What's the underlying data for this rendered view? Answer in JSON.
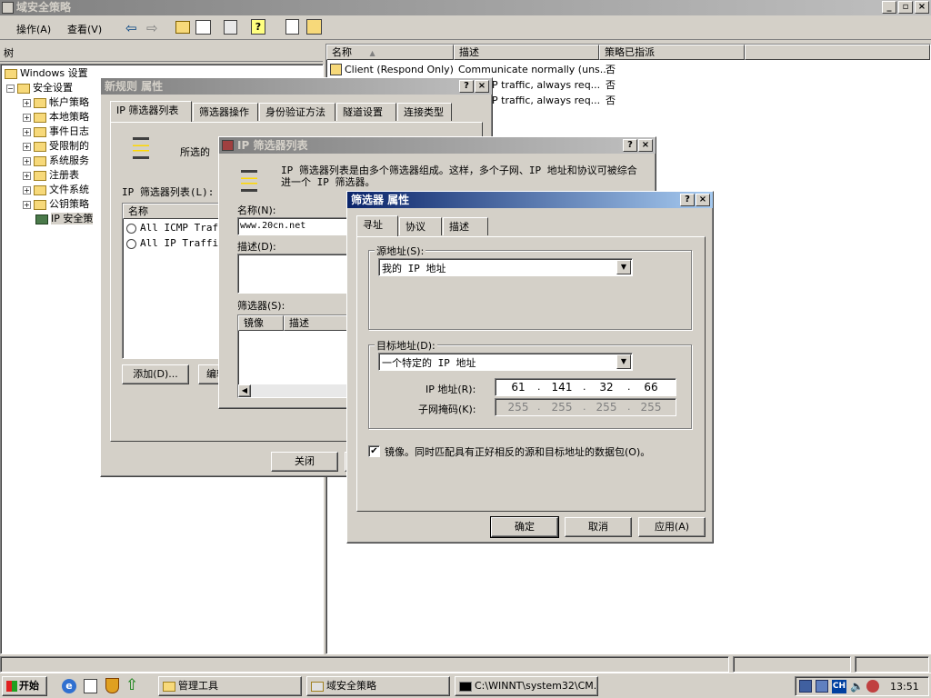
{
  "main_window": {
    "title": "域安全策略",
    "menu": [
      "操作(A)",
      "查看(V)"
    ],
    "tree_header": "树",
    "tree": [
      "Windows 设置",
      "安全设置",
      "帐户策略",
      "本地策略",
      "事件日志",
      "受限制的",
      "系统服务",
      "注册表",
      "文件系统",
      "公钥策略",
      "IP 安全策"
    ],
    "list_headers": [
      "名称",
      "描述",
      "策略已指派"
    ],
    "list_rows": [
      {
        "name": "Client (Respond Only)",
        "desc": "Communicate normally (uns...",
        "assigned": "否"
      },
      {
        "name": "",
        "desc": "P traffic, always req...",
        "assigned": "否"
      },
      {
        "name": "",
        "desc": "P traffic, always req...",
        "assigned": "否"
      }
    ]
  },
  "rule_dialog": {
    "title": "新规则 属性",
    "tabs": [
      "IP 筛选器列表",
      "筛选器操作",
      "身份验证方法",
      "隧道设置",
      "连接类型"
    ],
    "desc_text": "所选的",
    "list_label": "IP 筛选器列表(L):",
    "col_name": "名称",
    "items": [
      "All ICMP Traff",
      "All IP Traffic"
    ],
    "add_button": "添加(D)...",
    "edit_button": "编辑",
    "close_button": "关闭"
  },
  "filter_list_dialog": {
    "title": "IP 筛选器列表",
    "desc": "IP 筛选器列表是由多个筛选器组成。这样，多个子网、IP 地址和协议可被综合进一个 IP 筛选器。",
    "name_label": "名称(N):",
    "name_value": "www.20cn.net",
    "desc_label": "描述(D):",
    "filters_label": "筛选器(S):",
    "col_mirror": "镜像",
    "col_desc": "描述"
  },
  "filter_props": {
    "title": "筛选器 属性",
    "tabs": [
      "寻址",
      "协议",
      "描述"
    ],
    "source_label": "源地址(S):",
    "source_value": "我的 IP 地址",
    "dest_label": "目标地址(D):",
    "dest_value": "一个特定的 IP 地址",
    "ip_label": "IP 地址(R):",
    "ip": [
      "61",
      "141",
      "32",
      "66"
    ],
    "mask_label": "子网掩码(K):",
    "mask": [
      "255",
      "255",
      "255",
      "255"
    ],
    "mirror_label": "镜像。同时匹配具有正好相反的源和目标地址的数据包(O)。",
    "ok": "确定",
    "cancel": "取消",
    "apply": "应用(A)"
  },
  "taskbar": {
    "start": "开始",
    "tasks": [
      "管理工具",
      "域安全策略",
      "C:\\WINNT\\system32\\CM..."
    ],
    "tray_ime": "CH",
    "clock": "13:51"
  }
}
